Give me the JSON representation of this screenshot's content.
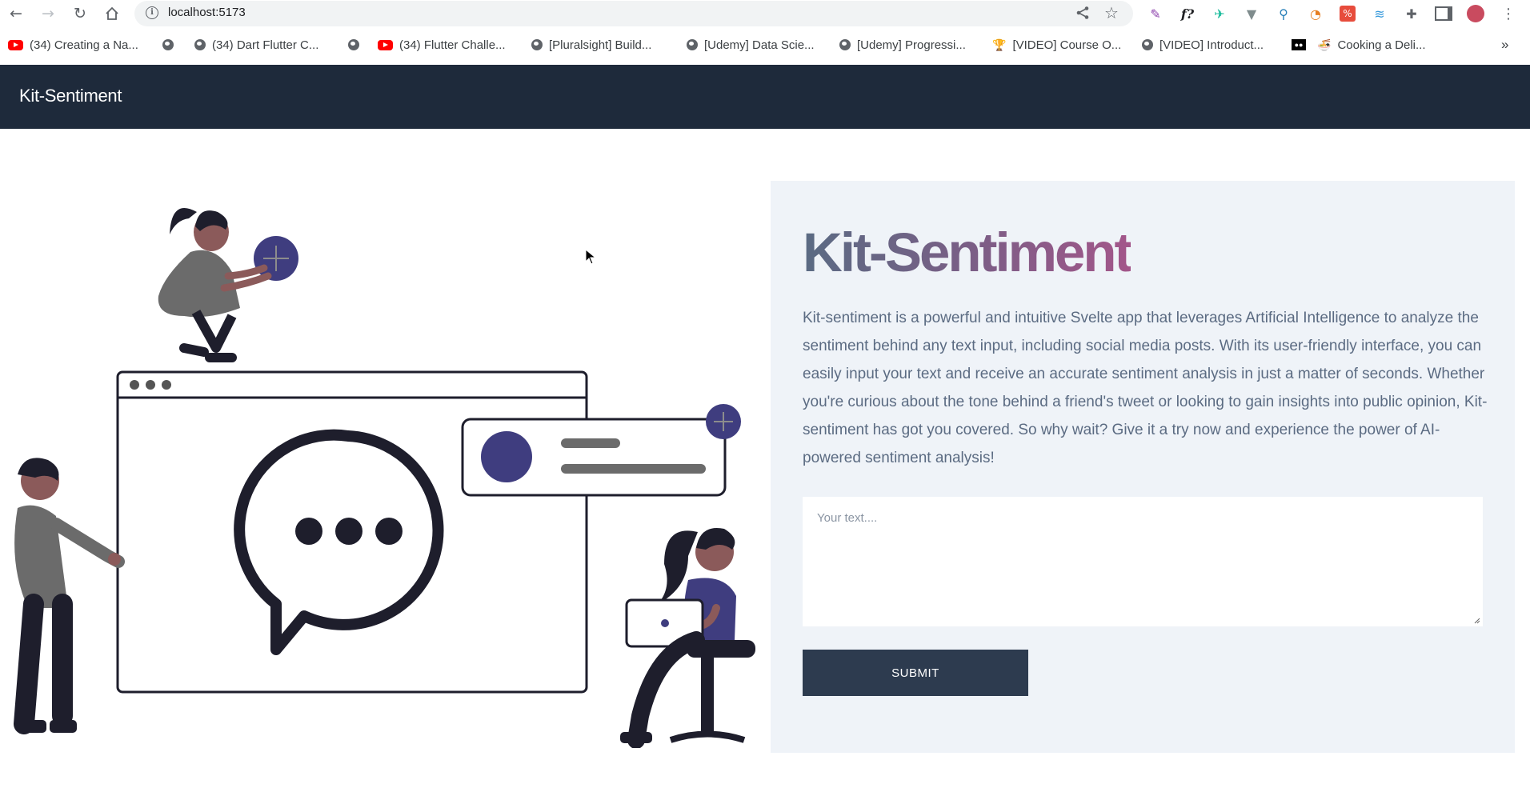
{
  "browser": {
    "url": "localhost:5173",
    "bookmarks": [
      {
        "label": "(34) Creating a Na...",
        "icon": "youtube-icon"
      },
      {
        "label": "",
        "icon": "globe-icon"
      },
      {
        "label": "(34) Dart Flutter C...",
        "icon": "globe-icon"
      },
      {
        "label": "",
        "icon": "globe-icon"
      },
      {
        "label": "(34) Flutter Challe...",
        "icon": "youtube-icon"
      },
      {
        "label": "[Pluralsight] Build...",
        "icon": "globe-icon"
      },
      {
        "label": "[Udemy] Data Scie...",
        "icon": "globe-icon"
      },
      {
        "label": "[Udemy] Progressi...",
        "icon": "globe-icon"
      },
      {
        "label": "[VIDEO] Course O...",
        "icon": "trophy-icon"
      },
      {
        "label": "[VIDEO] Introduct...",
        "icon": "globe-icon"
      },
      {
        "label": "",
        "icon": "medium-icon"
      },
      {
        "label": "Cooking a Deli...",
        "icon": "food-icon"
      }
    ],
    "more_bookmarks": "»"
  },
  "app": {
    "brand": "Kit-Sentiment",
    "title": "Kit-Sentiment",
    "description": "Kit-sentiment is a powerful and intuitive Svelte app that leverages Artificial Intelligence to analyze the sentiment behind any text input, including social media posts. With its user-friendly interface, you can easily input your text and receive an accurate sentiment analysis in just a matter of seconds. Whether you're curious about the tone behind a friend's tweet or looking to gain insights into public opinion, Kit-sentiment has got you covered. So why wait? Give it a try now and experience the power of AI-powered sentiment analysis!",
    "textarea_placeholder": "Your text....",
    "submit_label": "SUBMIT"
  },
  "colors": {
    "header_bg": "#1e2a3b",
    "panel_bg": "#eff3f8",
    "button_bg": "#2d3b4f",
    "accent": "#3f3d7f"
  }
}
